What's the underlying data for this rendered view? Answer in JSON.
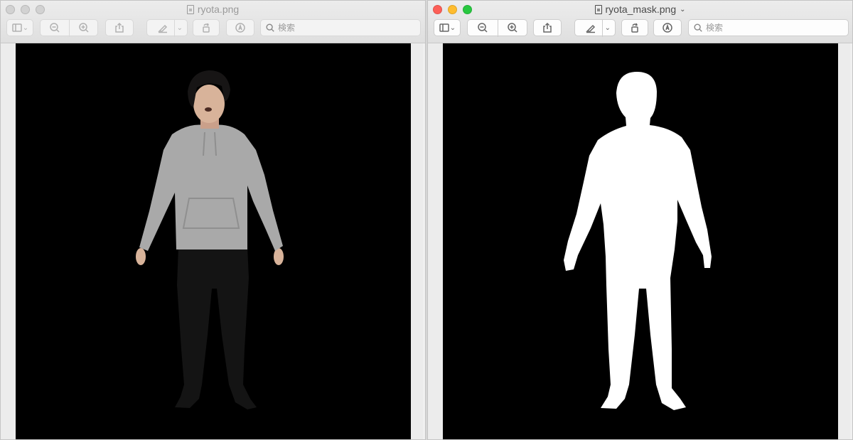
{
  "windows": [
    {
      "title": "ryota.png",
      "active": false,
      "search_placeholder": "検索"
    },
    {
      "title": "ryota_mask.png",
      "active": true,
      "search_placeholder": "検索"
    }
  ],
  "icons": {
    "sidebar": "sidebar-icon",
    "zoom_out": "zoom-out-icon",
    "zoom_in": "zoom-in-icon",
    "share": "share-icon",
    "markup": "highlighter-icon",
    "rotate": "rotate-icon",
    "annotate": "markup-pen-icon",
    "search": "search-icon"
  },
  "colors": {
    "background": "#000000",
    "mask": "#ffffff",
    "hoodie": "#a9a9a9",
    "pants": "#141414",
    "skin": "#d8b39a",
    "hair": "#171515",
    "close": "#fd5f57",
    "minimize": "#febc2e",
    "zoom": "#28c840"
  }
}
